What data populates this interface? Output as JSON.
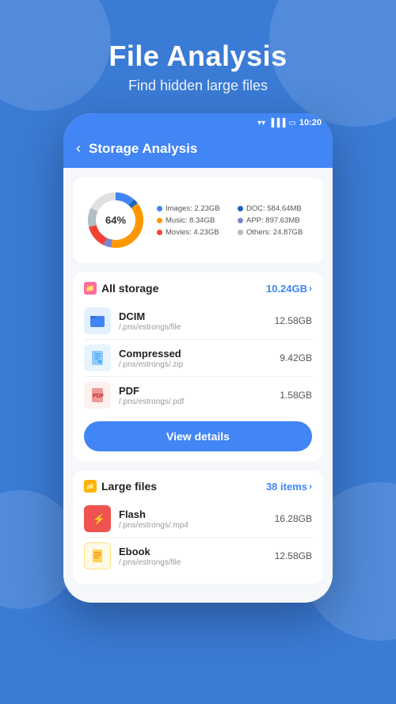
{
  "background": {
    "color": "#3a7bd5"
  },
  "header": {
    "title": "File Analysis",
    "subtitle": "Find hidden large files"
  },
  "phone": {
    "statusBar": {
      "time": "10:20"
    },
    "navBar": {
      "back_label": "<",
      "title": "Storage Analysis"
    },
    "chartCard": {
      "percentage": "64%",
      "legend": [
        {
          "label": "Images: 2.23GB",
          "color": "#4285f4"
        },
        {
          "label": "DOC: 584.64MB",
          "color": "#1565c0"
        },
        {
          "label": "Music: 8.34GB",
          "color": "#ff9800"
        },
        {
          "label": "APP: 897.63MB",
          "color": "#7986cb"
        },
        {
          "label": "Movies: 4.23GB",
          "color": "#f44336"
        },
        {
          "label": "Others: 24.87GB",
          "color": "#b0bec5"
        }
      ]
    },
    "allStorage": {
      "icon": "📁",
      "title": "All storage",
      "value": "10.24GB",
      "items": [
        {
          "icon": "folder",
          "name": "DCIM",
          "path": "/.pns/estrongs/file",
          "size": "12.58GB",
          "iconBg": "#4285f4"
        },
        {
          "icon": "zip",
          "name": "Compressed",
          "path": "/.pns/estrongs/.zip",
          "size": "9.42GB",
          "iconBg": "#42a5f5"
        },
        {
          "icon": "pdf",
          "name": "PDF",
          "path": "/.pns/estrongs/.pdf",
          "size": "1.58GB",
          "iconBg": "#ef5350"
        }
      ],
      "button": "View details"
    },
    "largeFiles": {
      "icon": "📁",
      "title": "Large files",
      "value": "38 items",
      "items": [
        {
          "icon": "flash",
          "name": "Flash",
          "path": "/.pns/estrongs/.mp4",
          "size": "16.28GB",
          "iconBg": "#ef5350"
        },
        {
          "icon": "ebook",
          "name": "Ebook",
          "path": "/.pns/estrongs/file",
          "size": "12.58GB",
          "iconBg": "#ffc107"
        }
      ]
    }
  }
}
